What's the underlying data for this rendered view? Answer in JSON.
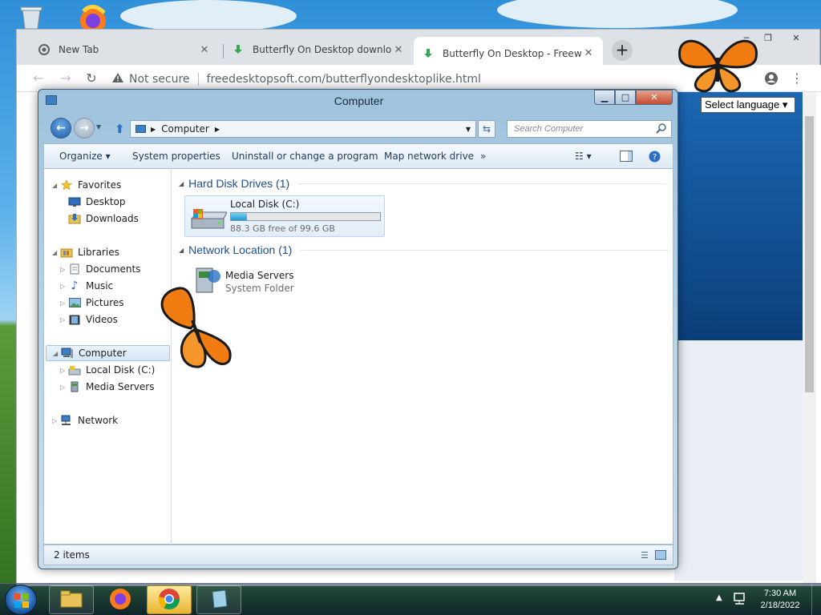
{
  "browser": {
    "tabs": [
      {
        "title": "New Tab",
        "active": false
      },
      {
        "title": "Butterfly On Desktop download p",
        "active": false
      },
      {
        "title": "Butterfly On Desktop - Freeware",
        "active": true
      }
    ],
    "new_tab_glyph": "+",
    "close_glyph": "✕",
    "security_label": "Not secure",
    "url": "freedesktopsoft.com/butterflyondesktoplike.html"
  },
  "page": {
    "language_select": "Select language ▾"
  },
  "explorer": {
    "title": "Computer",
    "address": "Computer",
    "search_placeholder": "Search Computer",
    "commands": [
      "Organize ▾",
      "System properties",
      "Uninstall or change a program",
      "Map network drive",
      "»"
    ],
    "nav": {
      "favorites": "Favorites",
      "desktop": "Desktop",
      "downloads": "Downloads",
      "libraries": "Libraries",
      "documents": "Documents",
      "music": "Music",
      "pictures": "Pictures",
      "videos": "Videos",
      "computer": "Computer",
      "local_disk": "Local Disk (C:)",
      "media_servers": "Media Servers",
      "network": "Network"
    },
    "groups": {
      "hard_disk": "Hard Disk Drives (1)",
      "network_location": "Network Location (1)"
    },
    "disk": {
      "name": "Local Disk (C:)",
      "free_text": "88.3 GB free of 99.6 GB",
      "used_fraction": 0.11
    },
    "media": {
      "name": "Media Servers",
      "type": "System Folder"
    },
    "status": "2 items"
  },
  "taskbar": {
    "time": "7:30 AM",
    "date": "2/18/2022"
  },
  "colors": {
    "butterfly": "#f07c12",
    "chrome_tabs": "#dee1e6",
    "explorer_frame": "#bcd5e8"
  }
}
